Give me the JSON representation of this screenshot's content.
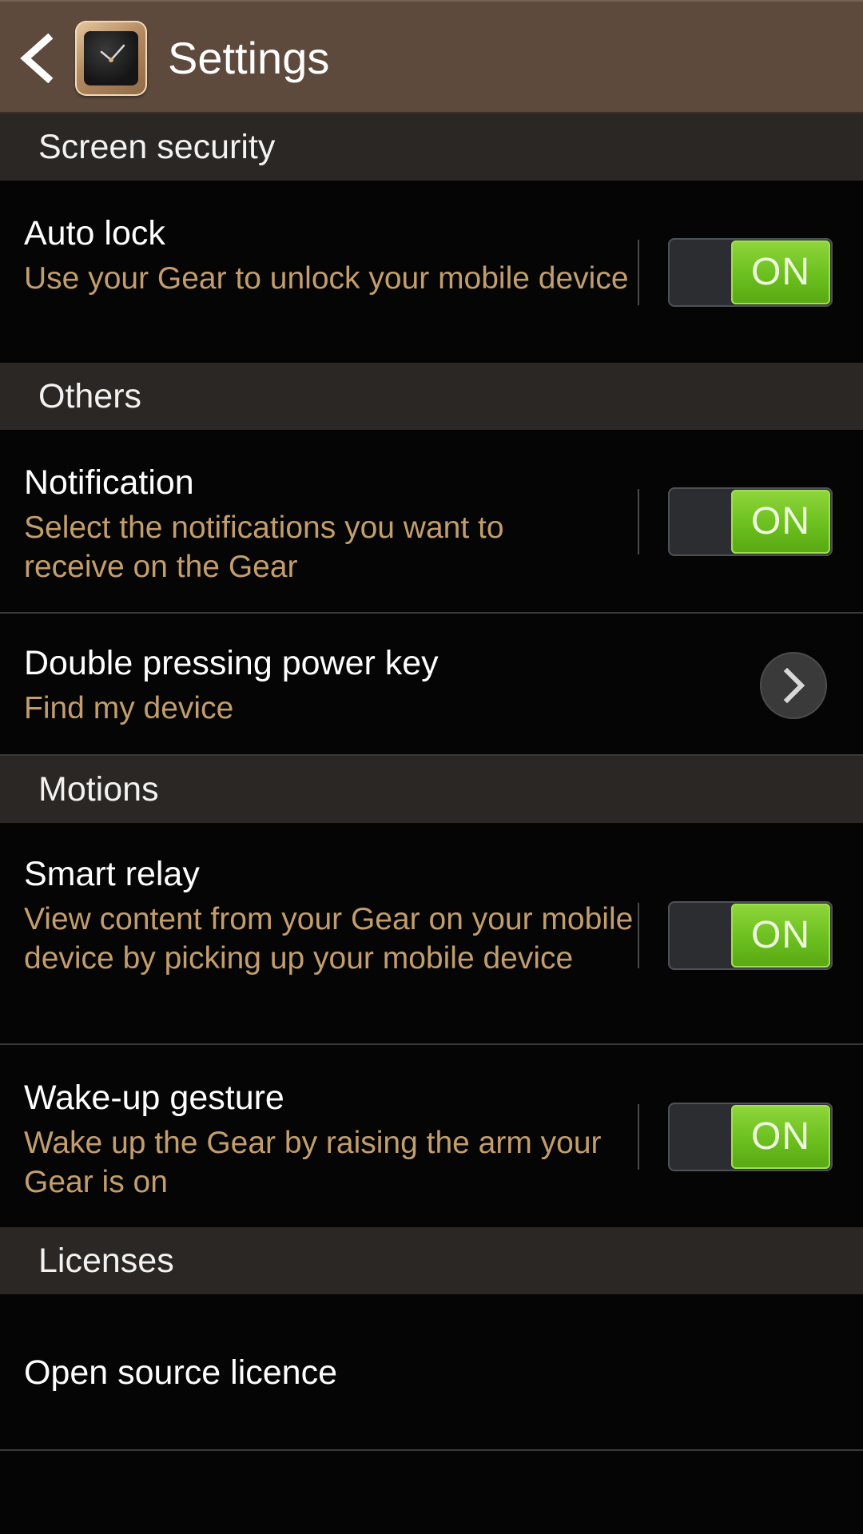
{
  "header": {
    "title": "Settings"
  },
  "sections": {
    "screen_security": "Screen security",
    "others": "Others",
    "motions": "Motions",
    "licenses": "Licenses"
  },
  "items": {
    "auto_lock": {
      "title": "Auto lock",
      "summary": "Use your Gear to unlock your mobile device",
      "toggle": "ON"
    },
    "notification": {
      "title": "Notification",
      "summary": "Select the notifications you want to receive on the Gear",
      "toggle": "ON"
    },
    "double_press": {
      "title": "Double pressing power key",
      "summary": "Find my device"
    },
    "smart_relay": {
      "title": "Smart relay",
      "summary": "View content from your Gear on your mobile device by picking up your mobile device",
      "toggle": "ON"
    },
    "wake_up": {
      "title": "Wake-up gesture",
      "summary": "Wake up the Gear by raising the arm your Gear is on",
      "toggle": "ON"
    },
    "open_source": {
      "title": "Open source licence"
    }
  },
  "colors": {
    "action_bar": "#5d4a3d",
    "section_header": "#2b2724",
    "summary_text": "#c39e6c",
    "toggle_on": "#6bbf1e"
  },
  "icons": {
    "back": "chevron-left-icon",
    "app": "gear-watch-icon",
    "more": "chevron-right-icon"
  }
}
